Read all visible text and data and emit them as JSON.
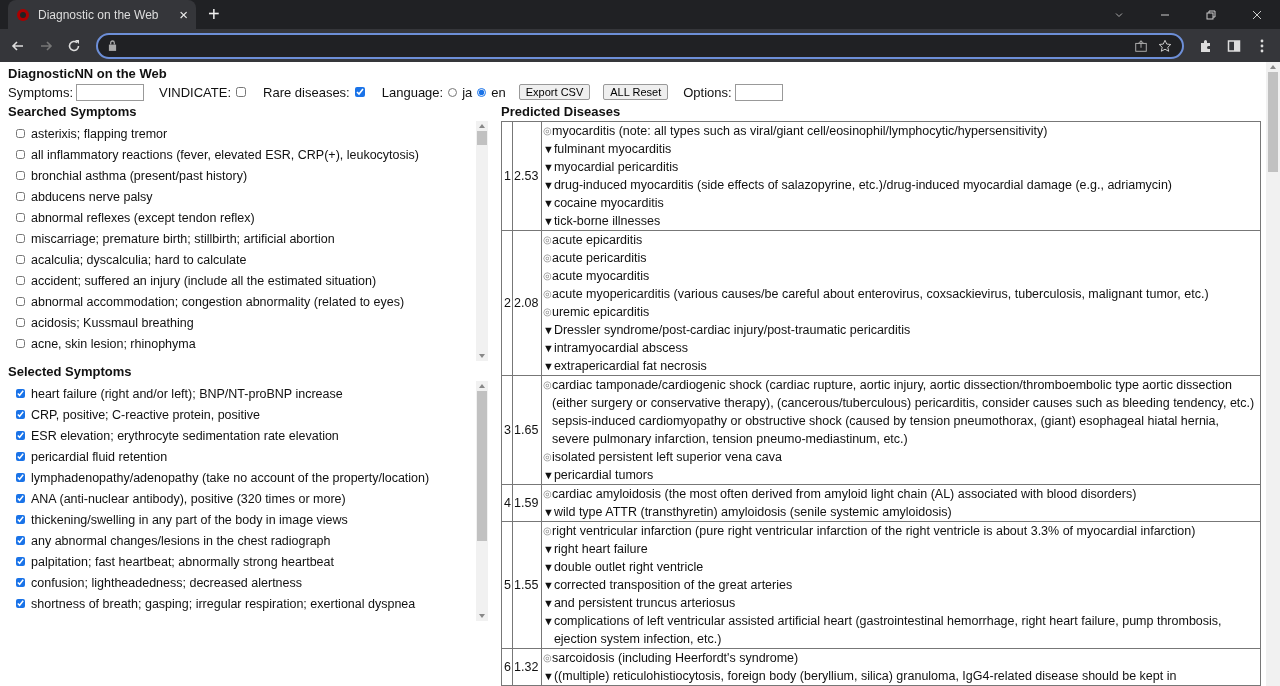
{
  "browser": {
    "tab_title": "Diagnostic on the Web",
    "new_tab": "+",
    "close_tab": "×"
  },
  "page": {
    "title": "DiagnosticNN on the Web",
    "symptoms_label": "Symptoms:",
    "vindicate": {
      "label": "VINDICATE:",
      "checked": false
    },
    "rare": {
      "label": "Rare diseases:",
      "checked": true
    },
    "language": {
      "label": "Language:",
      "options": [
        {
          "label": "ja",
          "selected": false
        },
        {
          "label": "en",
          "selected": true
        }
      ]
    },
    "buttons": [
      "Export CSV",
      "ALL Reset"
    ],
    "options_label": "Options:"
  },
  "searched": {
    "heading": "Searched Symptoms",
    "items": [
      {
        "label": "asterixis; flapping tremor",
        "checked": false
      },
      {
        "label": "all inflammatory reactions (fever, elevated ESR, CRP(+), leukocytosis)",
        "checked": false
      },
      {
        "label": "bronchial asthma (present/past history)",
        "checked": false
      },
      {
        "label": "abducens nerve palsy",
        "checked": false
      },
      {
        "label": "abnormal reflexes (except tendon reflex)",
        "checked": false
      },
      {
        "label": "miscarriage; premature birth; stillbirth; artificial abortion",
        "checked": false
      },
      {
        "label": "acalculia; dyscalculia; hard to calculate",
        "checked": false
      },
      {
        "label": "accident; suffered an injury (include all the estimated situation)",
        "checked": false
      },
      {
        "label": "abnormal accommodation; congestion abnormality (related to eyes)",
        "checked": false
      },
      {
        "label": "acidosis; Kussmaul breathing",
        "checked": false
      },
      {
        "label": "acne, skin lesion; rhinophyma",
        "checked": false
      }
    ]
  },
  "selected": {
    "heading": "Selected Symptoms",
    "items": [
      {
        "label": "heart failure (right and/or left); BNP/NT-proBNP increase",
        "checked": true
      },
      {
        "label": "CRP, positive; C-reactive protein, positive",
        "checked": true
      },
      {
        "label": "ESR elevation; erythrocyte sedimentation rate elevation",
        "checked": true
      },
      {
        "label": "pericardial fluid retention",
        "checked": true
      },
      {
        "label": "lymphadenopathy/adenopathy (take no account of the property/location)",
        "checked": true
      },
      {
        "label": "ANA (anti-nuclear antibody), positive (320 times or more)",
        "checked": true
      },
      {
        "label": "thickening/swelling in any part of the body in image views",
        "checked": true
      },
      {
        "label": "any abnormal changes/lesions in the chest radiograph",
        "checked": true
      },
      {
        "label": "palpitation; fast heartbeat; abnormally strong heartbeat",
        "checked": true
      },
      {
        "label": "confusion; lightheadedness; decreased alertness",
        "checked": true
      },
      {
        "label": "shortness of breath; gasping; irregular respiration; exertional dyspnea",
        "checked": true
      }
    ]
  },
  "predicted": {
    "heading": "Predicted Diseases",
    "rows": [
      {
        "rank": "1",
        "score": "2.53",
        "entries": [
          {
            "marker": "◎",
            "text": "myocarditis (note: all types such as viral/giant cell/eosinophil/lymphocytic/hypersensitivity)"
          },
          {
            "marker": "▼",
            "text": "fulminant myocarditis"
          },
          {
            "marker": "▼",
            "text": "myocardial pericarditis"
          },
          {
            "marker": "▼",
            "text": "drug-induced myocarditis (side effects of salazopyrine, etc.)/drug-induced myocardial damage (e.g., adriamycin)"
          },
          {
            "marker": "▼",
            "text": "cocaine myocarditis"
          },
          {
            "marker": "▼",
            "text": "tick-borne illnesses"
          }
        ]
      },
      {
        "rank": "2",
        "score": "2.08",
        "entries": [
          {
            "marker": "◎",
            "text": "acute epicarditis"
          },
          {
            "marker": "◎",
            "text": "acute pericarditis"
          },
          {
            "marker": "◎",
            "text": "acute myocarditis"
          },
          {
            "marker": "◎",
            "text": "acute myopericarditis (various causes/be careful about enterovirus, coxsackievirus, tuberculosis, malignant tumor, etc.)"
          },
          {
            "marker": "◎",
            "text": "uremic epicarditis"
          },
          {
            "marker": "▼",
            "text": "Dressler syndrome/post-cardiac injury/post-traumatic pericarditis"
          },
          {
            "marker": "▼",
            "text": "intramyocardial abscess"
          },
          {
            "marker": "▼",
            "text": "extrapericardial fat necrosis"
          }
        ]
      },
      {
        "rank": "3",
        "score": "1.65",
        "entries": [
          {
            "marker": "◎",
            "text": "cardiac tamponade/cardiogenic shock (cardiac rupture, aortic injury, aortic dissection/thromboembolic type aortic dissection (either surgery or conservative therapy), (cancerous/tuberculous) pericarditis, consider causes such as bleeding tendency, etc.) sepsis-induced cardiomyopathy or obstructive shock (caused by tension pneumothorax, (giant) esophageal hiatal hernia, severe pulmonary infarction, tension pneumo-mediastinum, etc.)"
          },
          {
            "marker": "◎",
            "text": "isolated persistent left superior vena cava"
          },
          {
            "marker": "▼",
            "text": "pericardial tumors"
          }
        ]
      },
      {
        "rank": "4",
        "score": "1.59",
        "entries": [
          {
            "marker": "◎",
            "text": "cardiac amyloidosis (the most often derived from amyloid light chain (AL) associated with blood disorders)"
          },
          {
            "marker": "▼",
            "text": "wild type ATTR (transthyretin) amyloidosis (senile systemic amyloidosis)"
          }
        ]
      },
      {
        "rank": "5",
        "score": "1.55",
        "entries": [
          {
            "marker": "◎",
            "text": "right ventricular infarction (pure right ventricular infarction of the right ventricle is about 3.3% of myocardial infarction)"
          },
          {
            "marker": "▼",
            "text": "right heart failure"
          },
          {
            "marker": "▼",
            "text": "double outlet right ventricle"
          },
          {
            "marker": "▼",
            "text": "corrected transposition of the great arteries"
          },
          {
            "marker": "▼",
            "text": "and persistent truncus arteriosus"
          },
          {
            "marker": "▼",
            "text": "complications of left ventricular assisted artificial heart (gastrointestinal hemorrhage, right heart failure, pump thrombosis, ejection system infection, etc.)"
          }
        ]
      },
      {
        "rank": "6",
        "score": "1.32",
        "entries": [
          {
            "marker": "◎",
            "text": "sarcoidosis (including Heerfordt's syndrome)"
          },
          {
            "marker": "▼",
            "text": "((multiple) reticulohistiocytosis, foreign body (beryllium, silica) granuloma, IgG4-related disease should be kept in"
          }
        ]
      }
    ]
  }
}
